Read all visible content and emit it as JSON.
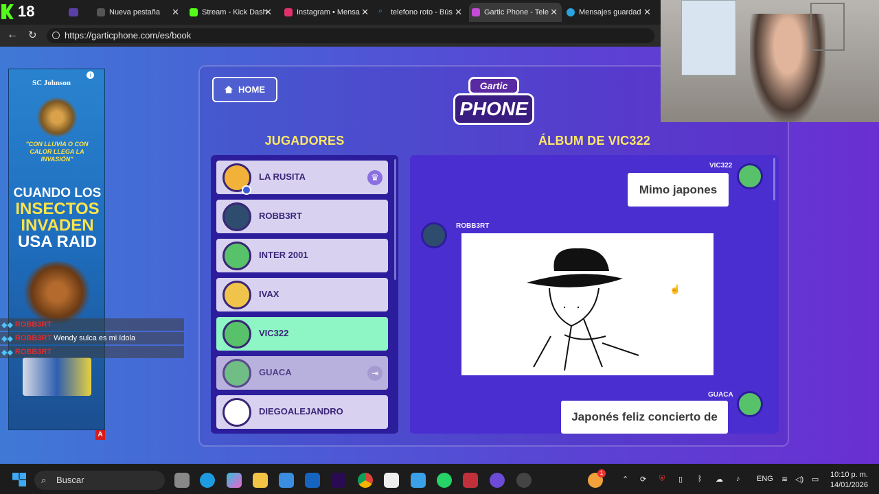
{
  "browser": {
    "tabs": [
      {
        "label": "Nueva pestaña",
        "color": "#555555"
      },
      {
        "label": "Stream - Kick Dash",
        "color": "#53fc18"
      },
      {
        "label": "Instagram • Mensa",
        "color": "#e1306c"
      },
      {
        "label": "telefono roto - Bús",
        "color": "#4285f4"
      },
      {
        "label": "Gartic Phone - Tele",
        "color": "#c44bd6"
      },
      {
        "label": "Mensajes guardad",
        "color": "#2aa3e0"
      }
    ],
    "badge": "18",
    "url": "https://garticphone.com/es/book"
  },
  "ad": {
    "brand": "SC Johnson",
    "quote": "\"CON LLUVIA O CON CALOR LLEGA LA INVASIÓN\"",
    "headline1": "CUANDO LOS",
    "headline2": "INSECTOS",
    "headline3": "INVADEN",
    "headline4": "USA RAID",
    "badge": "A"
  },
  "game": {
    "home_label": "HOME",
    "logo_top": "Gartic",
    "logo_bottom": "PHONE",
    "players_heading": "JUGADORES",
    "album_heading": "ÁLBUM DE VIC322",
    "players": [
      {
        "name": "LA RUSITA",
        "selected": false,
        "avatar_color": "#f2b23a",
        "icon": "crown-icon"
      },
      {
        "name": "ROBB3RT",
        "selected": false,
        "avatar_color": "#2e4d6e",
        "icon": ""
      },
      {
        "name": "INTER 2001",
        "selected": false,
        "avatar_color": "#58c26a",
        "icon": ""
      },
      {
        "name": "IVAX",
        "selected": false,
        "avatar_color": "#f0c44a",
        "icon": ""
      },
      {
        "name": "VIC322",
        "selected": true,
        "avatar_color": "#58c26a",
        "icon": ""
      },
      {
        "name": "GUACA",
        "selected": false,
        "avatar_color": "#58c26a",
        "icon": "exit-icon"
      },
      {
        "name": "DIEGOALEJANDRO",
        "selected": false,
        "avatar_color": "#ffffff",
        "icon": ""
      }
    ],
    "album": {
      "entries": [
        {
          "user": "VIC322",
          "text": "Mimo japones"
        },
        {
          "user": "ROBB3RT",
          "text": ""
        },
        {
          "user": "GUACA",
          "text": "Japonés feliz concierto de"
        }
      ]
    }
  },
  "chat": [
    {
      "user": "ROBB3RT",
      "message": ""
    },
    {
      "user": "ROBB3RT",
      "message": "Wendy sulca es mi ídola"
    },
    {
      "user": "ROBB3RT",
      "message": ""
    }
  ],
  "taskbar": {
    "search_label": "Buscar",
    "lang": "ENG",
    "time": "10:10 p. m.",
    "date": "14/01/2026",
    "notification_count": "1"
  }
}
